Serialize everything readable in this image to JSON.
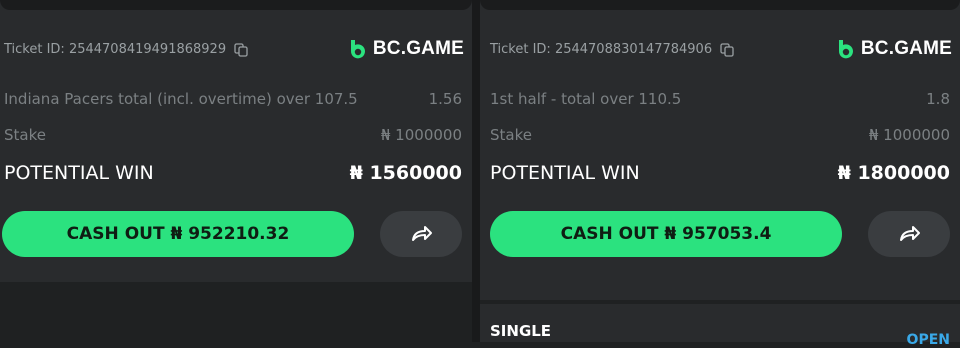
{
  "tickets": [
    {
      "ticket_id": "Ticket ID: 2544708419491868929",
      "brand": "BC.GAME",
      "market": "Indiana Pacers total (incl. overtime) over 107.5",
      "odds": "1.56",
      "stake_label": "Stake",
      "stake_value": "₦ 1000000",
      "win_label": "POTENTIAL WIN",
      "win_value": "₦ 1560000",
      "cashout_label": "CASH OUT ₦ 952210.32"
    },
    {
      "ticket_id": "Ticket ID: 2544708830147784906",
      "brand": "BC.GAME",
      "market": "1st half - total over 110.5",
      "odds": "1.8",
      "stake_label": "Stake",
      "stake_value": "₦ 1000000",
      "win_label": "POTENTIAL WIN",
      "win_value": "₦ 1800000",
      "cashout_label": "CASH OUT ₦ 957053.4"
    }
  ],
  "next_card": {
    "type_label": "SINGLE",
    "status_label": "OPEN"
  },
  "icons": {
    "copy": "copy-icon",
    "share": "share-arrow-icon",
    "brand": "bc-game-logo-icon"
  },
  "colors": {
    "accent_green": "#2be27f",
    "status_blue": "#3aa9e8"
  }
}
